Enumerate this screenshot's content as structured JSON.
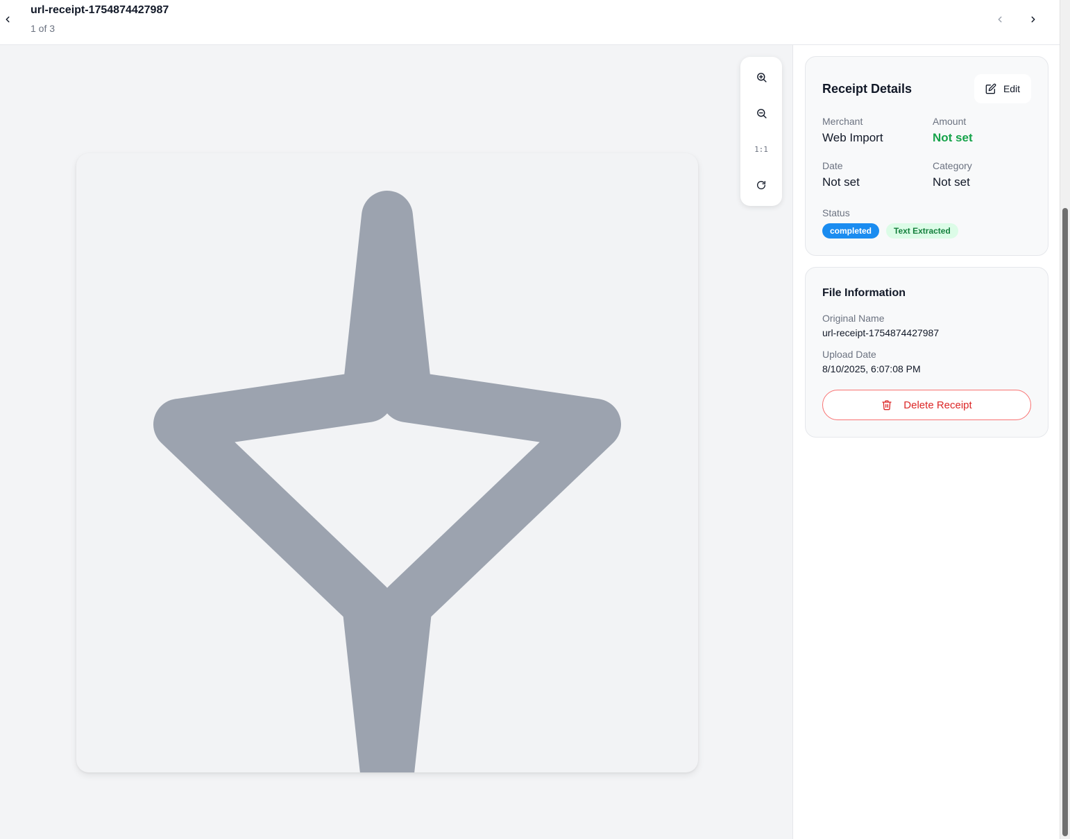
{
  "header": {
    "title": "url-receipt-1754874427987",
    "counter": "1 of 3"
  },
  "icons": {
    "back": "chevron-left-icon",
    "prev": "chevron-left-icon",
    "next": "chevron-right-icon",
    "zoom_in": "zoom-in-icon",
    "zoom_out": "zoom-out-icon",
    "rotate": "rotate-icon",
    "edit": "edit-icon",
    "delete": "trash-icon",
    "placeholder": "sparkle-icon"
  },
  "toolbar": {
    "reset_label": "1:1"
  },
  "details": {
    "title": "Receipt Details",
    "edit_label": "Edit",
    "merchant_label": "Merchant",
    "merchant_value": "Web Import",
    "amount_label": "Amount",
    "amount_value": "Not set",
    "date_label": "Date",
    "date_value": "Not set",
    "category_label": "Category",
    "category_value": "Not set",
    "status_label": "Status",
    "status_badge": "completed",
    "extraction_badge": "Text Extracted"
  },
  "file_info": {
    "title": "File Information",
    "original_name_label": "Original Name",
    "original_name_value": "url-receipt-1754874427987",
    "upload_date_label": "Upload Date",
    "upload_date_value": "8/10/2025, 6:07:08 PM",
    "delete_label": "Delete Receipt"
  },
  "colors": {
    "accent_blue": "#1a8cf0",
    "success_green": "#16a34a",
    "danger_red": "#dc2626",
    "placeholder_gray": "#9ca3af"
  }
}
